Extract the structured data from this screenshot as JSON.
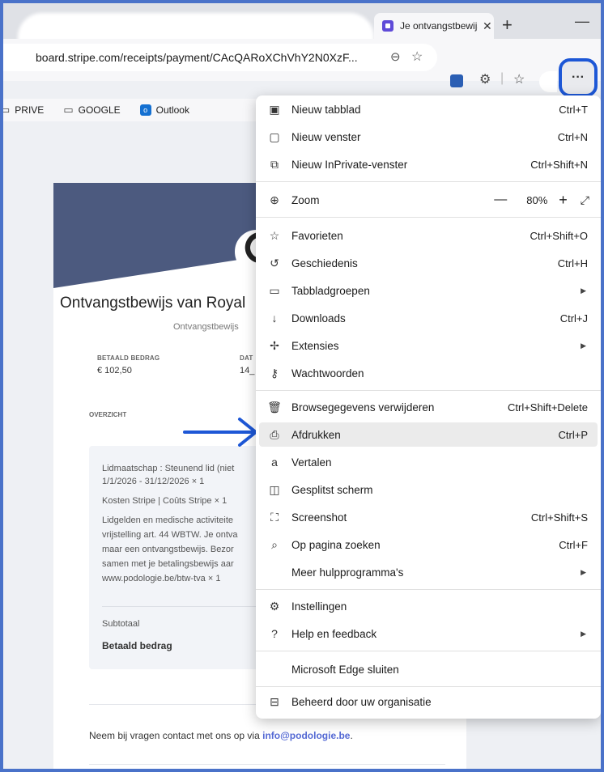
{
  "browser": {
    "tab_title": "Je ontvangstbewijs",
    "tab_close": "✕",
    "new_tab": "+",
    "minimize": "—",
    "address": "board.stripe.com/receipts/payment/CAcQARoXChVhY2N0XzF...",
    "more_label": "···"
  },
  "favorites": [
    {
      "label": "PRIVE",
      "icon": "folder-icon"
    },
    {
      "label": "GOOGLE",
      "icon": "folder-icon"
    },
    {
      "label": "Outlook",
      "icon": "outlook-icon"
    }
  ],
  "receipt": {
    "title": "Ontvangstbewijs van Royal",
    "subtitle": "Ontvangstbewijs",
    "paid_label": "BETAALD BEDRAG",
    "paid_value": "€ 102,50",
    "date_label": "DAT",
    "date_value": "14_",
    "overview_label": "OVERZICHT",
    "lines": [
      "Lidmaatschap : Steunend lid (niet",
      "1/1/2026 - 31/12/2026 × 1",
      "Kosten Stripe | Coûts Stripe × 1",
      "Lidgelden en medische activiteite",
      "vrijstelling art. 44 WBTW. Je ontva",
      "maar een ontvangstbewijs. Bezor",
      "samen met je betalingsbewijs aar",
      "www.podologie.be/btw-tva × 1"
    ],
    "subtotal_label": "Subtotaal",
    "paid_amount_label": "Betaald bedrag",
    "contact_text": "Neem bij vragen contact met ons op via ",
    "contact_email": "info@podologie.be",
    "contact_end": "."
  },
  "menu": {
    "new_tab": {
      "label": "Nieuw tabblad",
      "shortcut": "Ctrl+T"
    },
    "new_window": {
      "label": "Nieuw venster",
      "shortcut": "Ctrl+N"
    },
    "new_inprivate": {
      "label": "Nieuw InPrivate-venster",
      "shortcut": "Ctrl+Shift+N"
    },
    "zoom": {
      "label": "Zoom",
      "minus": "—",
      "value": "80%",
      "plus": "+",
      "fullscreen": "⤢"
    },
    "favorites": {
      "label": "Favorieten",
      "shortcut": "Ctrl+Shift+O"
    },
    "history": {
      "label": "Geschiedenis",
      "shortcut": "Ctrl+H"
    },
    "tab_groups": {
      "label": "Tabbladgroepen"
    },
    "downloads": {
      "label": "Downloads",
      "shortcut": "Ctrl+J"
    },
    "extensions": {
      "label": "Extensies"
    },
    "passwords": {
      "label": "Wachtwoorden"
    },
    "clear_data": {
      "label": "Browsegegevens verwijderen",
      "shortcut": "Ctrl+Shift+Delete"
    },
    "print": {
      "label": "Afdrukken",
      "shortcut": "Ctrl+P"
    },
    "translate": {
      "label": "Vertalen"
    },
    "split_screen": {
      "label": "Gesplitst scherm"
    },
    "screenshot": {
      "label": "Screenshot",
      "shortcut": "Ctrl+Shift+S"
    },
    "find": {
      "label": "Op pagina zoeken",
      "shortcut": "Ctrl+F"
    },
    "more_tools": {
      "label": "Meer hulpprogramma's"
    },
    "settings": {
      "label": "Instellingen"
    },
    "help": {
      "label": "Help en feedback"
    },
    "close_edge": {
      "label": "Microsoft Edge sluiten"
    },
    "managed": {
      "label": "Beheerd door uw organisatie"
    }
  },
  "colors": {
    "frame": "#4a72c9",
    "annotation_blue": "#1d57d6",
    "banner": "#4c5a7f",
    "link": "#5469d4"
  }
}
